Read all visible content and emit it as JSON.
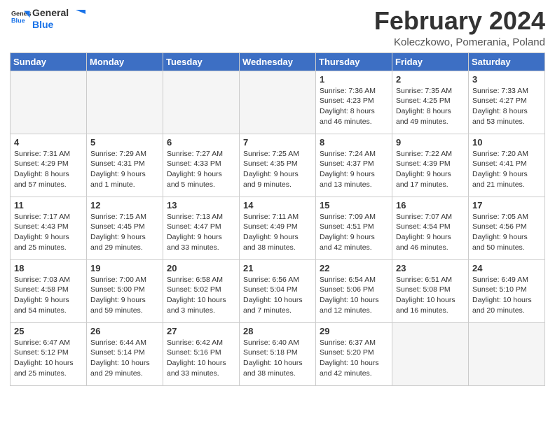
{
  "header": {
    "logo_general": "General",
    "logo_blue": "Blue",
    "title": "February 2024",
    "subtitle": "Koleczkowo, Pomerania, Poland"
  },
  "weekdays": [
    "Sunday",
    "Monday",
    "Tuesday",
    "Wednesday",
    "Thursday",
    "Friday",
    "Saturday"
  ],
  "weeks": [
    [
      {
        "day": "",
        "info": ""
      },
      {
        "day": "",
        "info": ""
      },
      {
        "day": "",
        "info": ""
      },
      {
        "day": "",
        "info": ""
      },
      {
        "day": "1",
        "info": "Sunrise: 7:36 AM\nSunset: 4:23 PM\nDaylight: 8 hours\nand 46 minutes."
      },
      {
        "day": "2",
        "info": "Sunrise: 7:35 AM\nSunset: 4:25 PM\nDaylight: 8 hours\nand 49 minutes."
      },
      {
        "day": "3",
        "info": "Sunrise: 7:33 AM\nSunset: 4:27 PM\nDaylight: 8 hours\nand 53 minutes."
      }
    ],
    [
      {
        "day": "4",
        "info": "Sunrise: 7:31 AM\nSunset: 4:29 PM\nDaylight: 8 hours\nand 57 minutes."
      },
      {
        "day": "5",
        "info": "Sunrise: 7:29 AM\nSunset: 4:31 PM\nDaylight: 9 hours\nand 1 minute."
      },
      {
        "day": "6",
        "info": "Sunrise: 7:27 AM\nSunset: 4:33 PM\nDaylight: 9 hours\nand 5 minutes."
      },
      {
        "day": "7",
        "info": "Sunrise: 7:25 AM\nSunset: 4:35 PM\nDaylight: 9 hours\nand 9 minutes."
      },
      {
        "day": "8",
        "info": "Sunrise: 7:24 AM\nSunset: 4:37 PM\nDaylight: 9 hours\nand 13 minutes."
      },
      {
        "day": "9",
        "info": "Sunrise: 7:22 AM\nSunset: 4:39 PM\nDaylight: 9 hours\nand 17 minutes."
      },
      {
        "day": "10",
        "info": "Sunrise: 7:20 AM\nSunset: 4:41 PM\nDaylight: 9 hours\nand 21 minutes."
      }
    ],
    [
      {
        "day": "11",
        "info": "Sunrise: 7:17 AM\nSunset: 4:43 PM\nDaylight: 9 hours\nand 25 minutes."
      },
      {
        "day": "12",
        "info": "Sunrise: 7:15 AM\nSunset: 4:45 PM\nDaylight: 9 hours\nand 29 minutes."
      },
      {
        "day": "13",
        "info": "Sunrise: 7:13 AM\nSunset: 4:47 PM\nDaylight: 9 hours\nand 33 minutes."
      },
      {
        "day": "14",
        "info": "Sunrise: 7:11 AM\nSunset: 4:49 PM\nDaylight: 9 hours\nand 38 minutes."
      },
      {
        "day": "15",
        "info": "Sunrise: 7:09 AM\nSunset: 4:51 PM\nDaylight: 9 hours\nand 42 minutes."
      },
      {
        "day": "16",
        "info": "Sunrise: 7:07 AM\nSunset: 4:54 PM\nDaylight: 9 hours\nand 46 minutes."
      },
      {
        "day": "17",
        "info": "Sunrise: 7:05 AM\nSunset: 4:56 PM\nDaylight: 9 hours\nand 50 minutes."
      }
    ],
    [
      {
        "day": "18",
        "info": "Sunrise: 7:03 AM\nSunset: 4:58 PM\nDaylight: 9 hours\nand 54 minutes."
      },
      {
        "day": "19",
        "info": "Sunrise: 7:00 AM\nSunset: 5:00 PM\nDaylight: 9 hours\nand 59 minutes."
      },
      {
        "day": "20",
        "info": "Sunrise: 6:58 AM\nSunset: 5:02 PM\nDaylight: 10 hours\nand 3 minutes."
      },
      {
        "day": "21",
        "info": "Sunrise: 6:56 AM\nSunset: 5:04 PM\nDaylight: 10 hours\nand 7 minutes."
      },
      {
        "day": "22",
        "info": "Sunrise: 6:54 AM\nSunset: 5:06 PM\nDaylight: 10 hours\nand 12 minutes."
      },
      {
        "day": "23",
        "info": "Sunrise: 6:51 AM\nSunset: 5:08 PM\nDaylight: 10 hours\nand 16 minutes."
      },
      {
        "day": "24",
        "info": "Sunrise: 6:49 AM\nSunset: 5:10 PM\nDaylight: 10 hours\nand 20 minutes."
      }
    ],
    [
      {
        "day": "25",
        "info": "Sunrise: 6:47 AM\nSunset: 5:12 PM\nDaylight: 10 hours\nand 25 minutes."
      },
      {
        "day": "26",
        "info": "Sunrise: 6:44 AM\nSunset: 5:14 PM\nDaylight: 10 hours\nand 29 minutes."
      },
      {
        "day": "27",
        "info": "Sunrise: 6:42 AM\nSunset: 5:16 PM\nDaylight: 10 hours\nand 33 minutes."
      },
      {
        "day": "28",
        "info": "Sunrise: 6:40 AM\nSunset: 5:18 PM\nDaylight: 10 hours\nand 38 minutes."
      },
      {
        "day": "29",
        "info": "Sunrise: 6:37 AM\nSunset: 5:20 PM\nDaylight: 10 hours\nand 42 minutes."
      },
      {
        "day": "",
        "info": ""
      },
      {
        "day": "",
        "info": ""
      }
    ]
  ]
}
